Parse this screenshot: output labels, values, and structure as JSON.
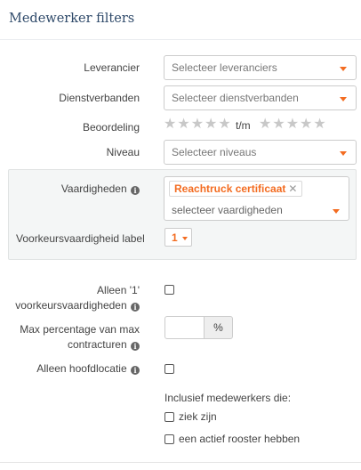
{
  "header": {
    "title": "Medewerker filters"
  },
  "fields": {
    "leverancier": {
      "label": "Leverancier",
      "placeholder": "Selecteer leveranciers"
    },
    "dienstverbanden": {
      "label": "Dienstverbanden",
      "placeholder": "Selecteer dienstverbanden"
    },
    "beoordeling": {
      "label": "Beoordeling",
      "separator": "t/m",
      "from_stars": 0,
      "to_stars": 0,
      "max_stars": 5
    },
    "niveau": {
      "label": "Niveau",
      "placeholder": "Selecteer niveaus"
    }
  },
  "skills_panel": {
    "vaardigheden_label": "Vaardigheden",
    "selected_tag": "Reachtruck certificaat",
    "remove_symbol": "✕",
    "placeholder": "selecteer vaardigheden",
    "voorkeur_label": "Voorkeursvaardigheid label",
    "voorkeur_value": "1"
  },
  "options": {
    "alleen_voorkeur": {
      "label_line1": "Alleen '1'",
      "label_line2": "voorkeursvaardigheden",
      "checked": false
    },
    "max_percentage": {
      "label_line1": "Max percentage van max",
      "label_line2": "contracturen",
      "value": "",
      "unit": "%"
    },
    "alleen_hoofdlocatie": {
      "label": "Alleen hoofdlocatie",
      "checked": false
    }
  },
  "inclusief": {
    "heading": "Inclusief medewerkers die:",
    "items": [
      {
        "label": "ziek zijn",
        "checked": false
      },
      {
        "label": "een actief rooster hebben",
        "checked": false
      }
    ]
  },
  "icons": {
    "info": "info-circle-icon",
    "caret": "caret-down-icon",
    "star": "star-icon"
  },
  "colors": {
    "accent": "#f36c21",
    "title": "#2f4a6a",
    "star_empty": "#c8c8c8",
    "panel_bg": "#f4f6f6"
  }
}
